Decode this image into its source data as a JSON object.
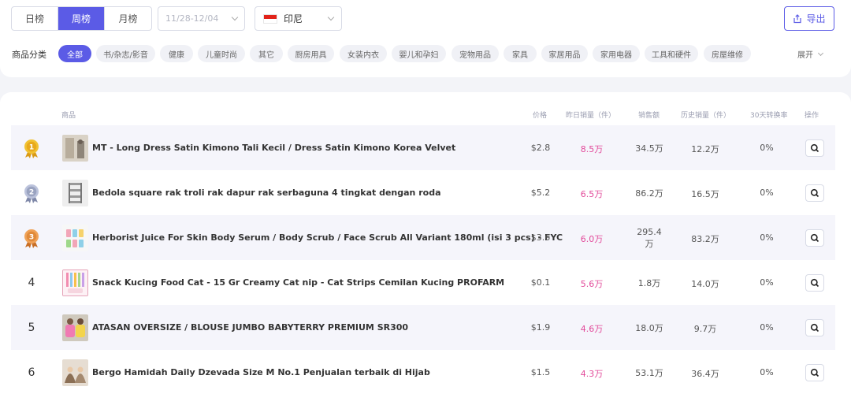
{
  "period": {
    "tabs": [
      "日榜",
      "周榜",
      "月榜"
    ],
    "active_index": 1
  },
  "date_range": {
    "placeholder": "11/28-12/04"
  },
  "country": {
    "label": "印尼"
  },
  "export": {
    "label": "导出",
    "color": "#5b5be6"
  },
  "categories": {
    "label": "商品分类",
    "items": [
      "全部",
      "书/杂志/影音",
      "健康",
      "儿童时尚",
      "其它",
      "厨房用具",
      "女装内衣",
      "婴儿和孕妇",
      "宠物用品",
      "家具",
      "家居用品",
      "家用电器",
      "工具和硬件",
      "房屋维修"
    ],
    "active_index": 0,
    "expand_label": "展开"
  },
  "table": {
    "headers": {
      "product": "商品",
      "price": "价格",
      "yesterday_sales": "昨日销量（件）",
      "sales_amount": "销售额",
      "history_sales": "历史销量（件）",
      "conversion_30d": "30天转换率",
      "actions": "操作"
    },
    "rows": [
      {
        "rank": "1",
        "medal": "gold",
        "name": "MT - Long Dress Satin Kimono Tali Kecil / Dress Satin Kimono Korea Velvet",
        "price": "$2.8",
        "yesterday_sales": "8.5万",
        "sales_amount": "34.5万",
        "history_sales": "12.2万",
        "conversion_30d": "0%"
      },
      {
        "rank": "2",
        "medal": "silver",
        "name": "Bedola square rak troli rak dapur rak serbaguna 4 tingkat dengan roda",
        "price": "$5.2",
        "yesterday_sales": "6.5万",
        "sales_amount": "86.2万",
        "history_sales": "16.5万",
        "conversion_30d": "0%"
      },
      {
        "rank": "3",
        "medal": "bronze",
        "name": "Herborist Juice For Skin Body Serum / Body Scrub / Face Scrub All Variant 180ml (isi 3 pcs) - FYC",
        "price": "$3.6",
        "yesterday_sales": "6.0万",
        "sales_amount_line1": "295.4",
        "sales_amount_line2": "万",
        "history_sales": "83.2万",
        "conversion_30d": "0%"
      },
      {
        "rank": "4",
        "medal": "",
        "name": "Snack Kucing Food Cat - 15 Gr Creamy Cat nip - Cat Strips Cemilan Kucing PROFARM",
        "price": "$0.1",
        "yesterday_sales": "5.6万",
        "sales_amount": "1.8万",
        "history_sales": "14.0万",
        "conversion_30d": "0%"
      },
      {
        "rank": "5",
        "medal": "",
        "name": "ATASAN OVERSIZE / BLOUSE JUMBO BABYTERRY PREMIUM SR300",
        "price": "$1.9",
        "yesterday_sales": "4.6万",
        "sales_amount": "18.0万",
        "history_sales": "9.7万",
        "conversion_30d": "0%"
      },
      {
        "rank": "6",
        "medal": "",
        "name": "Bergo Hamidah Daily Dzevada Size M No.1 Penjualan terbaik di Hijab",
        "price": "$1.5",
        "yesterday_sales": "4.3万",
        "sales_amount": "53.1万",
        "history_sales": "36.4万",
        "conversion_30d": "0%"
      }
    ]
  },
  "colors": {
    "accent": "#5b5be6",
    "sales_pink": "#e24a9a",
    "gold": "#e8b820",
    "silver": "#9aa3c0",
    "bronze": "#e08a3a"
  }
}
